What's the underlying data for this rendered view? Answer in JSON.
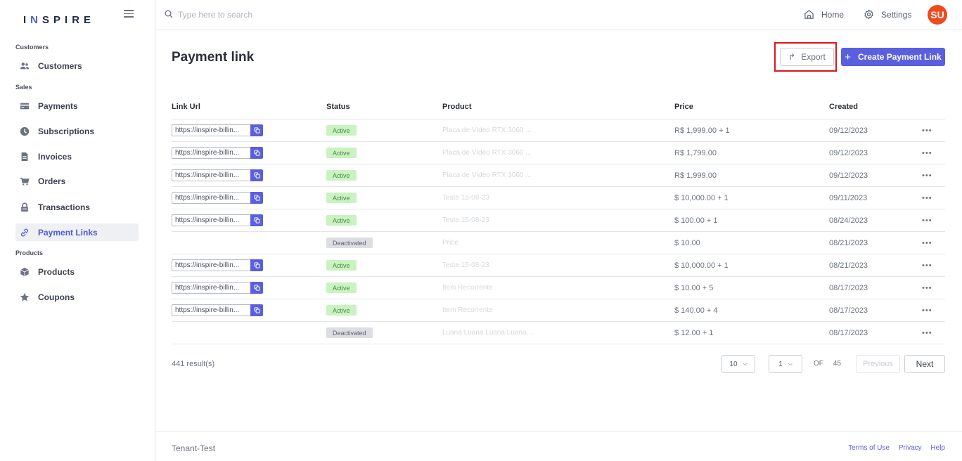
{
  "brand": {
    "logo_text_1": "I",
    "logo_text_n": "N",
    "logo_text_2": "SPIRE"
  },
  "sidebar": {
    "sections": [
      {
        "label": "Customers"
      },
      {
        "label": "Sales"
      },
      {
        "label": "Products"
      }
    ],
    "items": [
      {
        "label": "Customers",
        "icon": "users-icon"
      },
      {
        "label": "Payments",
        "icon": "credit-card-icon"
      },
      {
        "label": "Subscriptions",
        "icon": "clock-icon"
      },
      {
        "label": "Invoices",
        "icon": "file-icon"
      },
      {
        "label": "Orders",
        "icon": "cart-icon"
      },
      {
        "label": "Transactions",
        "icon": "lock-icon"
      },
      {
        "label": "Payment Links",
        "icon": "link-icon",
        "active": true
      },
      {
        "label": "Products",
        "icon": "box-icon"
      },
      {
        "label": "Coupons",
        "icon": "star-icon"
      }
    ]
  },
  "header": {
    "search_placeholder": "Type here to search",
    "home_label": "Home",
    "settings_label": "Settings",
    "avatar_initials": "SU"
  },
  "page": {
    "title": "Payment link",
    "export_label": "Export",
    "create_label": "Create Payment Link"
  },
  "table": {
    "columns": [
      "Link Url",
      "Status",
      "Product",
      "Price",
      "Created"
    ],
    "rows": [
      {
        "link": "https://inspire-billin...",
        "status": "Active",
        "product": "Placa de Vídeo RTX 3060 ...",
        "price": "R$ 1,999.00 + 1",
        "created": "09/12/2023"
      },
      {
        "link": "https://inspire-billin...",
        "status": "Active",
        "product": "Placa de Vídeo RTX 3060 ...",
        "price": "R$ 1,799.00",
        "created": "09/12/2023"
      },
      {
        "link": "https://inspire-billin...",
        "status": "Active",
        "product": "Placa de Vídeo RTX 3060 ...",
        "price": "R$ 1,999.00",
        "created": "09/12/2023"
      },
      {
        "link": "https://inspire-billin...",
        "status": "Active",
        "product": "Teste 15-08-23",
        "price": "$ 10,000.00 + 1",
        "created": "09/11/2023"
      },
      {
        "link": "https://inspire-billin...",
        "status": "Active",
        "product": "Teste 15-08-23",
        "price": "$ 100.00 + 1",
        "created": "08/24/2023"
      },
      {
        "link": "",
        "status": "Deactivated",
        "product": "Price",
        "price": "$ 10.00",
        "created": "08/21/2023"
      },
      {
        "link": "https://inspire-billin...",
        "status": "Active",
        "product": "Teste 15-08-23",
        "price": "$ 10,000.00 + 1",
        "created": "08/21/2023"
      },
      {
        "link": "https://inspire-billin...",
        "status": "Active",
        "product": "Item Recorrente",
        "price": "$ 10.00 + 5",
        "created": "08/17/2023"
      },
      {
        "link": "https://inspire-billin...",
        "status": "Active",
        "product": "Item Recorrente",
        "price": "$ 140.00 + 4",
        "created": "08/17/2023"
      },
      {
        "link": "",
        "status": "Deactivated",
        "product": "Luana Luana Luana Luana...",
        "price": "$ 12.00 + 1",
        "created": "08/17/2023"
      }
    ],
    "row_menu_label": "•••"
  },
  "pagination": {
    "results": "441 result(s)",
    "page_size": "10",
    "page": "1",
    "of_label": "OF",
    "total_pages": "45",
    "prev_label": "Previous",
    "next_label": "Next"
  },
  "footer": {
    "tenant": "Tenant-Test",
    "terms": "Terms of Use",
    "privacy": "Privacy",
    "help": "Help"
  },
  "colors": {
    "accent": "#5a5fe0",
    "active_badge": "#c9f3c0",
    "deactivated_badge": "#dcdee2",
    "avatar": "#ef4a1b",
    "highlight": "#e0151b"
  }
}
